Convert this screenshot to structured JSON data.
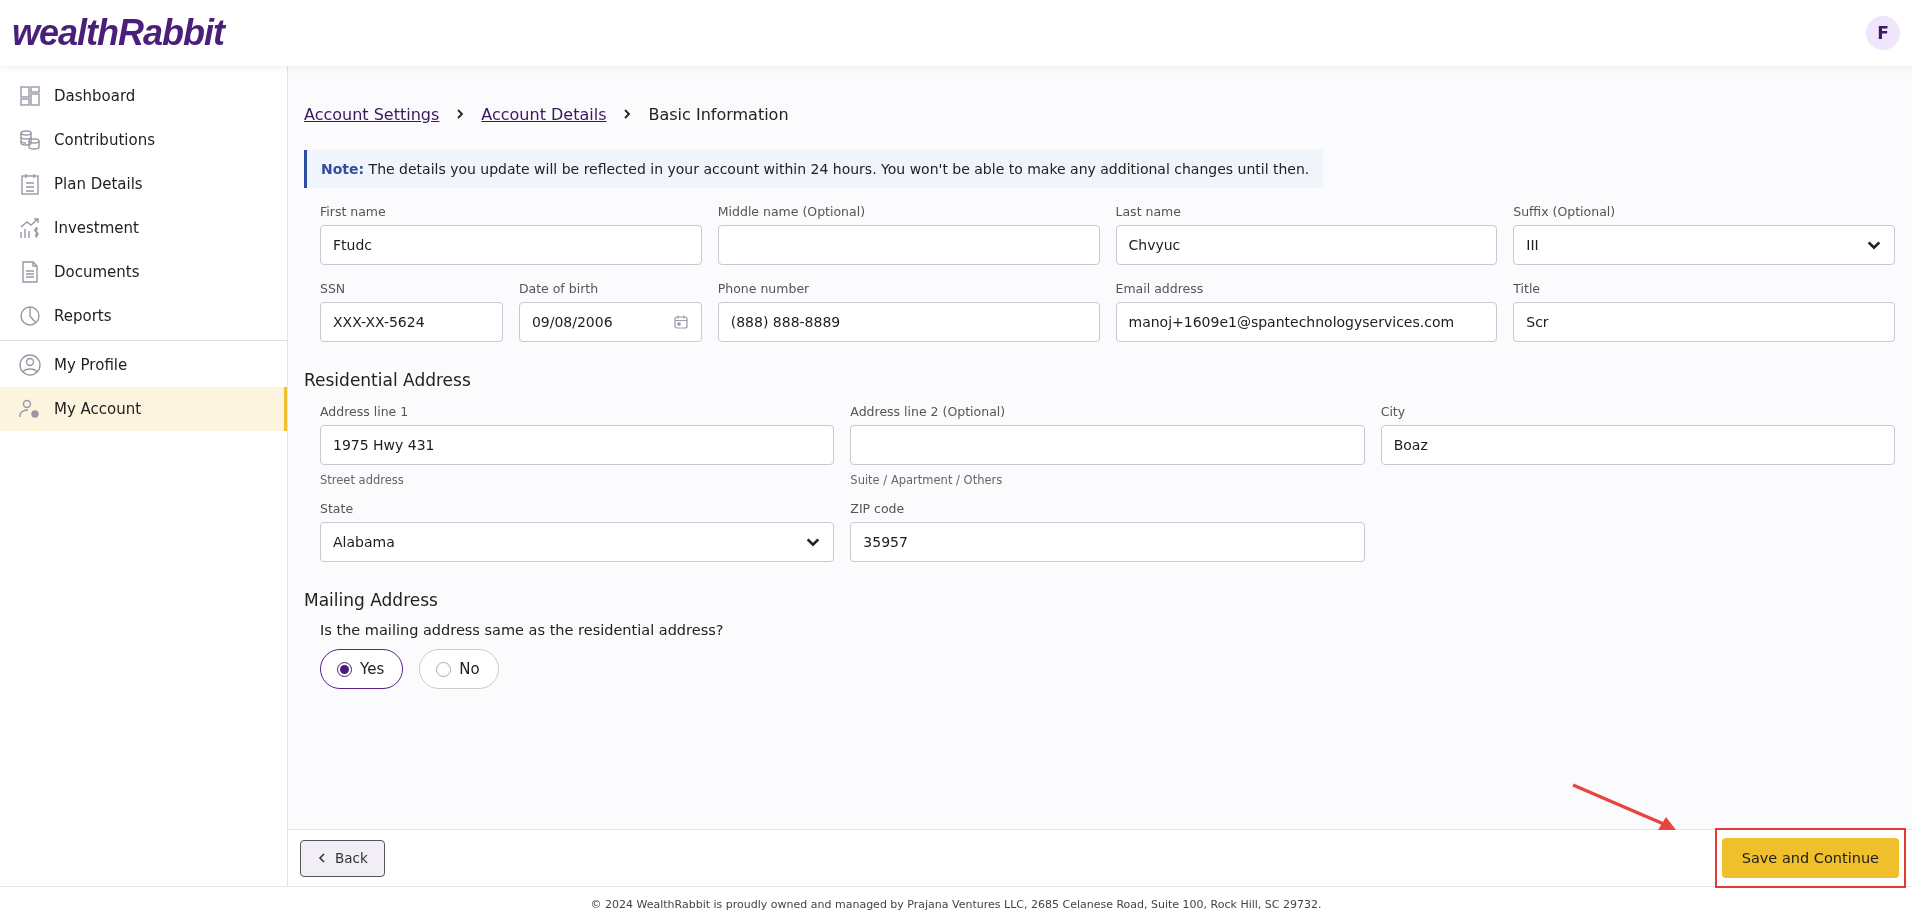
{
  "header": {
    "logo": "wealthRabbit",
    "avatar": "F"
  },
  "sidebar": {
    "items": [
      {
        "label": "Dashboard",
        "selected": false
      },
      {
        "label": "Contributions",
        "selected": false
      },
      {
        "label": "Plan Details",
        "selected": false
      },
      {
        "label": "Investment",
        "selected": false
      },
      {
        "label": "Documents",
        "selected": false
      },
      {
        "label": "Reports",
        "selected": false
      },
      {
        "label": "My Profile",
        "selected": false
      },
      {
        "label": "My Account",
        "selected": true
      }
    ]
  },
  "breadcrumb": [
    {
      "label": "Account Settings",
      "link": true
    },
    {
      "label": "Account Details",
      "link": true
    },
    {
      "label": "Basic Information",
      "link": false
    }
  ],
  "note": {
    "label": "Note:",
    "text": "The details you update will be reflected in your account within 24 hours. You won't be able to make any additional changes until then."
  },
  "personal_rows": [
    [
      {
        "label": "First name",
        "value": "Ftudc",
        "kind": "text"
      },
      {
        "label": "Middle name (Optional)",
        "kind": "text"
      },
      {
        "label": "Last name",
        "value": "Chvyuc",
        "kind": "text"
      },
      {
        "label": "Suffix (Optional)",
        "value": "III",
        "kind": "select"
      }
    ],
    [
      {
        "label": "SSN",
        "value": "XXX-XX-5624",
        "kind": "text"
      },
      {
        "label": "Date of birth",
        "value": "09/08/2006",
        "kind": "date"
      },
      {
        "label": "Phone number",
        "value": "(888) 888-8889",
        "kind": "text"
      },
      {
        "label": "Email address",
        "value": "manoj+1609e1@spantechnologyservices.com",
        "kind": "text"
      },
      {
        "label": "Title",
        "value": "Scr",
        "kind": "text"
      }
    ]
  ],
  "residential": {
    "title": "Residential Address",
    "rows": [
      [
        {
          "label": "Address line 1",
          "value": "1975 Hwy 431",
          "kind": "text",
          "hint": "Street address"
        },
        {
          "label": "Address line 2 (Optional)",
          "kind": "text",
          "hint": "Suite / Apartment / Others"
        },
        {
          "label": "City",
          "value": "Boaz",
          "kind": "text"
        }
      ],
      [
        {
          "label": "State",
          "value": "Alabama",
          "kind": "select"
        },
        {
          "label": "ZIP code",
          "value": "35957",
          "kind": "text"
        }
      ]
    ]
  },
  "mailing": {
    "title": "Mailing Address",
    "question": "Is the mailing address same as the residential address?",
    "options": [
      {
        "label": "Yes",
        "selected": true
      },
      {
        "label": "No",
        "selected": false
      }
    ]
  },
  "actions": {
    "back": "Back",
    "save": "Save and Continue"
  },
  "footer": "© 2024 WealthRabbit is proudly owned and managed by Prajana Ventures LLC, 2685 Celanese Road, Suite 100, Rock Hill, SC 29732."
}
